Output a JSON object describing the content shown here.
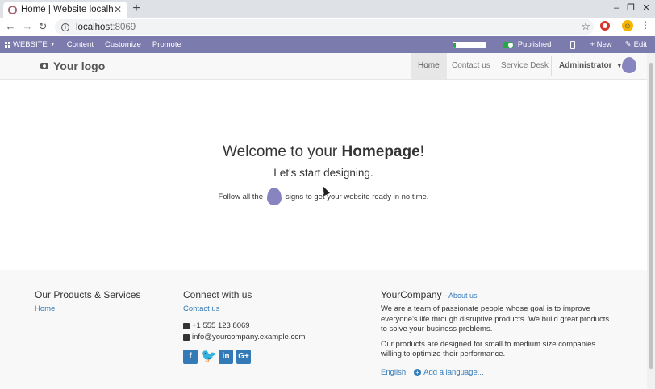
{
  "browser": {
    "tab_title": "Home | Website localhost",
    "url_host": "localhost",
    "url_port": ":8069"
  },
  "adminbar": {
    "website_label": "WEBSITE",
    "content_label": "Content",
    "customize_label": "Customize",
    "promote_label": "Promote",
    "progress_fraction": 0.08,
    "published_label": "Published",
    "new_label": "+ New",
    "edit_label": "Edit"
  },
  "sitenav": {
    "logo_text": "Your logo",
    "items": [
      {
        "label": "Home",
        "active": true
      },
      {
        "label": "Contact us",
        "active": false
      },
      {
        "label": "Service Desk",
        "active": false
      }
    ],
    "admin_label": "Administrator"
  },
  "hero": {
    "title_prefix": "Welcome to your ",
    "title_bold": "Homepage",
    "title_suffix": "!",
    "subtitle": "Let's start designing.",
    "line_prefix": "Follow all the",
    "line_suffix": "signs to get your website ready in no time."
  },
  "footer": {
    "products": {
      "heading": "Our Products & Services",
      "links": [
        "Home"
      ]
    },
    "connect": {
      "heading": "Connect with us",
      "contact_link": "Contact us",
      "phone": "+1 555 123 8069",
      "email": "info@yourcompany.example.com"
    },
    "company": {
      "heading": "YourCompany",
      "about_link": "- About us",
      "para1": "We are a team of passionate people whose goal is to improve everyone's life through disruptive products. We build great products to solve your business problems.",
      "para2": "Our products are designed for small to medium size companies willing to optimize their performance.",
      "language": "English",
      "add_language": "Add a language..."
    }
  },
  "colors": {
    "adminbar": "#7c7bad",
    "link": "#337ab7",
    "published": "#28a745"
  }
}
